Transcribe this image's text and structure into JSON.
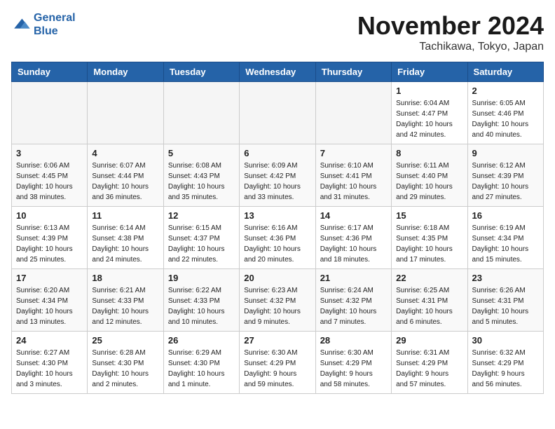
{
  "logo": {
    "line1": "General",
    "line2": "Blue"
  },
  "title": "November 2024",
  "location": "Tachikawa, Tokyo, Japan",
  "weekdays": [
    "Sunday",
    "Monday",
    "Tuesday",
    "Wednesday",
    "Thursday",
    "Friday",
    "Saturday"
  ],
  "weeks": [
    [
      {
        "day": "",
        "info": ""
      },
      {
        "day": "",
        "info": ""
      },
      {
        "day": "",
        "info": ""
      },
      {
        "day": "",
        "info": ""
      },
      {
        "day": "",
        "info": ""
      },
      {
        "day": "1",
        "info": "Sunrise: 6:04 AM\nSunset: 4:47 PM\nDaylight: 10 hours\nand 42 minutes."
      },
      {
        "day": "2",
        "info": "Sunrise: 6:05 AM\nSunset: 4:46 PM\nDaylight: 10 hours\nand 40 minutes."
      }
    ],
    [
      {
        "day": "3",
        "info": "Sunrise: 6:06 AM\nSunset: 4:45 PM\nDaylight: 10 hours\nand 38 minutes."
      },
      {
        "day": "4",
        "info": "Sunrise: 6:07 AM\nSunset: 4:44 PM\nDaylight: 10 hours\nand 36 minutes."
      },
      {
        "day": "5",
        "info": "Sunrise: 6:08 AM\nSunset: 4:43 PM\nDaylight: 10 hours\nand 35 minutes."
      },
      {
        "day": "6",
        "info": "Sunrise: 6:09 AM\nSunset: 4:42 PM\nDaylight: 10 hours\nand 33 minutes."
      },
      {
        "day": "7",
        "info": "Sunrise: 6:10 AM\nSunset: 4:41 PM\nDaylight: 10 hours\nand 31 minutes."
      },
      {
        "day": "8",
        "info": "Sunrise: 6:11 AM\nSunset: 4:40 PM\nDaylight: 10 hours\nand 29 minutes."
      },
      {
        "day": "9",
        "info": "Sunrise: 6:12 AM\nSunset: 4:39 PM\nDaylight: 10 hours\nand 27 minutes."
      }
    ],
    [
      {
        "day": "10",
        "info": "Sunrise: 6:13 AM\nSunset: 4:39 PM\nDaylight: 10 hours\nand 25 minutes."
      },
      {
        "day": "11",
        "info": "Sunrise: 6:14 AM\nSunset: 4:38 PM\nDaylight: 10 hours\nand 24 minutes."
      },
      {
        "day": "12",
        "info": "Sunrise: 6:15 AM\nSunset: 4:37 PM\nDaylight: 10 hours\nand 22 minutes."
      },
      {
        "day": "13",
        "info": "Sunrise: 6:16 AM\nSunset: 4:36 PM\nDaylight: 10 hours\nand 20 minutes."
      },
      {
        "day": "14",
        "info": "Sunrise: 6:17 AM\nSunset: 4:36 PM\nDaylight: 10 hours\nand 18 minutes."
      },
      {
        "day": "15",
        "info": "Sunrise: 6:18 AM\nSunset: 4:35 PM\nDaylight: 10 hours\nand 17 minutes."
      },
      {
        "day": "16",
        "info": "Sunrise: 6:19 AM\nSunset: 4:34 PM\nDaylight: 10 hours\nand 15 minutes."
      }
    ],
    [
      {
        "day": "17",
        "info": "Sunrise: 6:20 AM\nSunset: 4:34 PM\nDaylight: 10 hours\nand 13 minutes."
      },
      {
        "day": "18",
        "info": "Sunrise: 6:21 AM\nSunset: 4:33 PM\nDaylight: 10 hours\nand 12 minutes."
      },
      {
        "day": "19",
        "info": "Sunrise: 6:22 AM\nSunset: 4:33 PM\nDaylight: 10 hours\nand 10 minutes."
      },
      {
        "day": "20",
        "info": "Sunrise: 6:23 AM\nSunset: 4:32 PM\nDaylight: 10 hours\nand 9 minutes."
      },
      {
        "day": "21",
        "info": "Sunrise: 6:24 AM\nSunset: 4:32 PM\nDaylight: 10 hours\nand 7 minutes."
      },
      {
        "day": "22",
        "info": "Sunrise: 6:25 AM\nSunset: 4:31 PM\nDaylight: 10 hours\nand 6 minutes."
      },
      {
        "day": "23",
        "info": "Sunrise: 6:26 AM\nSunset: 4:31 PM\nDaylight: 10 hours\nand 5 minutes."
      }
    ],
    [
      {
        "day": "24",
        "info": "Sunrise: 6:27 AM\nSunset: 4:30 PM\nDaylight: 10 hours\nand 3 minutes."
      },
      {
        "day": "25",
        "info": "Sunrise: 6:28 AM\nSunset: 4:30 PM\nDaylight: 10 hours\nand 2 minutes."
      },
      {
        "day": "26",
        "info": "Sunrise: 6:29 AM\nSunset: 4:30 PM\nDaylight: 10 hours\nand 1 minute."
      },
      {
        "day": "27",
        "info": "Sunrise: 6:30 AM\nSunset: 4:29 PM\nDaylight: 9 hours\nand 59 minutes."
      },
      {
        "day": "28",
        "info": "Sunrise: 6:30 AM\nSunset: 4:29 PM\nDaylight: 9 hours\nand 58 minutes."
      },
      {
        "day": "29",
        "info": "Sunrise: 6:31 AM\nSunset: 4:29 PM\nDaylight: 9 hours\nand 57 minutes."
      },
      {
        "day": "30",
        "info": "Sunrise: 6:32 AM\nSunset: 4:29 PM\nDaylight: 9 hours\nand 56 minutes."
      }
    ]
  ]
}
